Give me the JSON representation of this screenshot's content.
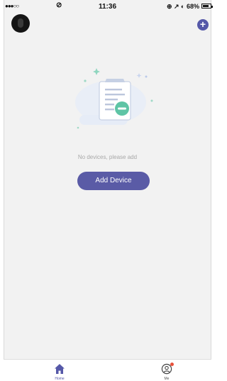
{
  "status_bar": {
    "time": "11:36",
    "signal": "●●●○○",
    "right_indicators": "⊕ ↗ ◐ 68%"
  },
  "header": {
    "add_icon_glyph": "+"
  },
  "empty_state": {
    "message": "No devices, please add",
    "button_label": "Add Device"
  },
  "tabbar": {
    "home_label": "Home",
    "me_label": "Me"
  },
  "colors": {
    "accent": "#5558a8",
    "background": "#f2f2f2",
    "muted_text": "#a8a8a8",
    "badge": "#e8503a",
    "illustration_teal": "#5ec4a5"
  }
}
